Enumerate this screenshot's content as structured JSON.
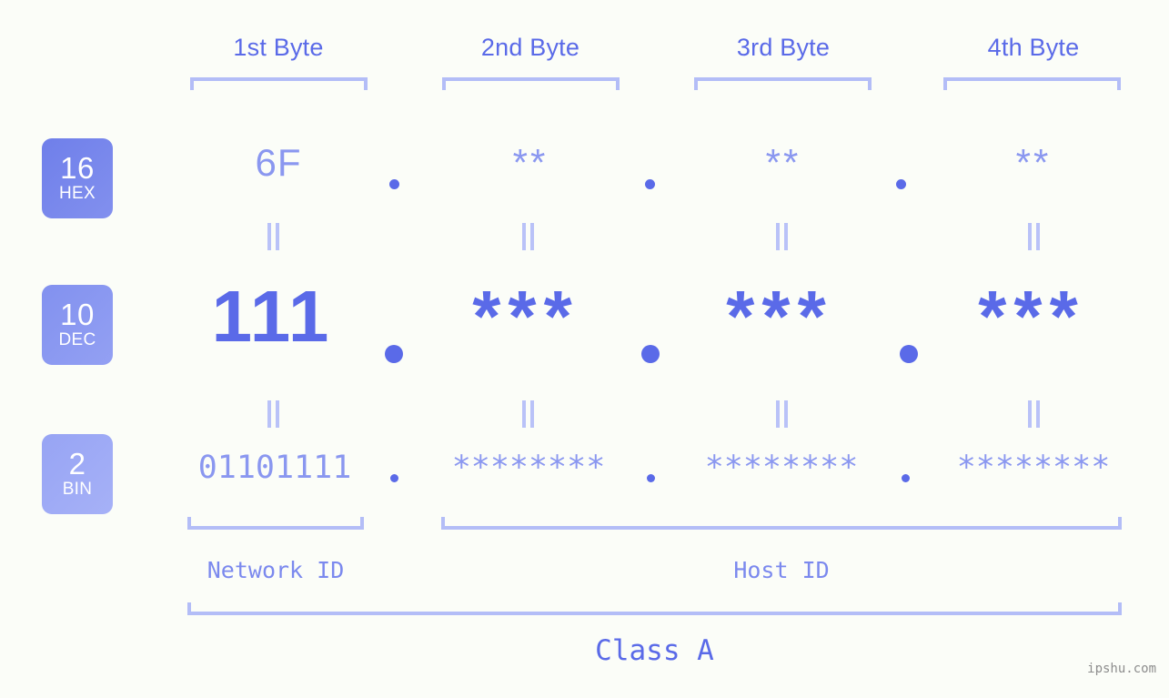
{
  "page": {
    "background_color": "#fbfdf8",
    "accent_color": "#5a6ae8",
    "accent_light_color": "#8a97f0",
    "bracket_color": "#b3bdf7",
    "watermark": "ipshu.com"
  },
  "byte_headers": [
    {
      "label": "1st Byte"
    },
    {
      "label": "2nd Byte"
    },
    {
      "label": "3rd Byte"
    },
    {
      "label": "4th Byte"
    }
  ],
  "bases": [
    {
      "number": "16",
      "abbr": "HEX"
    },
    {
      "number": "10",
      "abbr": "DEC"
    },
    {
      "number": "2",
      "abbr": "BIN"
    }
  ],
  "rows": {
    "hex": {
      "base_number": "16",
      "base_abbr": "HEX",
      "values": [
        "6F",
        "**",
        "**",
        "**"
      ],
      "separator": "."
    },
    "dec": {
      "base_number": "10",
      "base_abbr": "DEC",
      "values": [
        "111",
        "***",
        "***",
        "***"
      ],
      "separator": "."
    },
    "bin": {
      "base_number": "2",
      "base_abbr": "BIN",
      "values": [
        "01101111",
        "********",
        "********",
        "********"
      ],
      "separator": "."
    }
  },
  "equals_marks": {
    "symbol": "=",
    "count_per_row": 4,
    "rows": 2
  },
  "id_sections": [
    {
      "label": "Network ID"
    },
    {
      "label": "Host ID"
    }
  ],
  "class_section": {
    "label": "Class A"
  }
}
